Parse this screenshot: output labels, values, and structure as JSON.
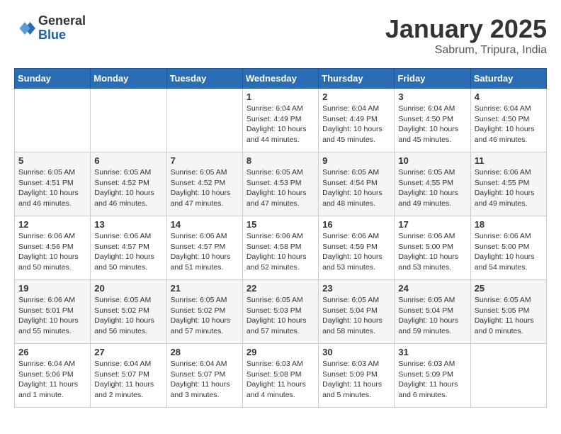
{
  "header": {
    "logo_general": "General",
    "logo_blue": "Blue",
    "month_title": "January 2025",
    "location": "Sabrum, Tripura, India"
  },
  "days_of_week": [
    "Sunday",
    "Monday",
    "Tuesday",
    "Wednesday",
    "Thursday",
    "Friday",
    "Saturday"
  ],
  "weeks": [
    [
      {
        "day": "",
        "info": ""
      },
      {
        "day": "",
        "info": ""
      },
      {
        "day": "",
        "info": ""
      },
      {
        "day": "1",
        "info": "Sunrise: 6:04 AM\nSunset: 4:49 PM\nDaylight: 10 hours\nand 44 minutes."
      },
      {
        "day": "2",
        "info": "Sunrise: 6:04 AM\nSunset: 4:49 PM\nDaylight: 10 hours\nand 45 minutes."
      },
      {
        "day": "3",
        "info": "Sunrise: 6:04 AM\nSunset: 4:50 PM\nDaylight: 10 hours\nand 45 minutes."
      },
      {
        "day": "4",
        "info": "Sunrise: 6:04 AM\nSunset: 4:50 PM\nDaylight: 10 hours\nand 46 minutes."
      }
    ],
    [
      {
        "day": "5",
        "info": "Sunrise: 6:05 AM\nSunset: 4:51 PM\nDaylight: 10 hours\nand 46 minutes."
      },
      {
        "day": "6",
        "info": "Sunrise: 6:05 AM\nSunset: 4:52 PM\nDaylight: 10 hours\nand 46 minutes."
      },
      {
        "day": "7",
        "info": "Sunrise: 6:05 AM\nSunset: 4:52 PM\nDaylight: 10 hours\nand 47 minutes."
      },
      {
        "day": "8",
        "info": "Sunrise: 6:05 AM\nSunset: 4:53 PM\nDaylight: 10 hours\nand 47 minutes."
      },
      {
        "day": "9",
        "info": "Sunrise: 6:05 AM\nSunset: 4:54 PM\nDaylight: 10 hours\nand 48 minutes."
      },
      {
        "day": "10",
        "info": "Sunrise: 6:05 AM\nSunset: 4:55 PM\nDaylight: 10 hours\nand 49 minutes."
      },
      {
        "day": "11",
        "info": "Sunrise: 6:06 AM\nSunset: 4:55 PM\nDaylight: 10 hours\nand 49 minutes."
      }
    ],
    [
      {
        "day": "12",
        "info": "Sunrise: 6:06 AM\nSunset: 4:56 PM\nDaylight: 10 hours\nand 50 minutes."
      },
      {
        "day": "13",
        "info": "Sunrise: 6:06 AM\nSunset: 4:57 PM\nDaylight: 10 hours\nand 50 minutes."
      },
      {
        "day": "14",
        "info": "Sunrise: 6:06 AM\nSunset: 4:57 PM\nDaylight: 10 hours\nand 51 minutes."
      },
      {
        "day": "15",
        "info": "Sunrise: 6:06 AM\nSunset: 4:58 PM\nDaylight: 10 hours\nand 52 minutes."
      },
      {
        "day": "16",
        "info": "Sunrise: 6:06 AM\nSunset: 4:59 PM\nDaylight: 10 hours\nand 53 minutes."
      },
      {
        "day": "17",
        "info": "Sunrise: 6:06 AM\nSunset: 5:00 PM\nDaylight: 10 hours\nand 53 minutes."
      },
      {
        "day": "18",
        "info": "Sunrise: 6:06 AM\nSunset: 5:00 PM\nDaylight: 10 hours\nand 54 minutes."
      }
    ],
    [
      {
        "day": "19",
        "info": "Sunrise: 6:06 AM\nSunset: 5:01 PM\nDaylight: 10 hours\nand 55 minutes."
      },
      {
        "day": "20",
        "info": "Sunrise: 6:05 AM\nSunset: 5:02 PM\nDaylight: 10 hours\nand 56 minutes."
      },
      {
        "day": "21",
        "info": "Sunrise: 6:05 AM\nSunset: 5:02 PM\nDaylight: 10 hours\nand 57 minutes."
      },
      {
        "day": "22",
        "info": "Sunrise: 6:05 AM\nSunset: 5:03 PM\nDaylight: 10 hours\nand 57 minutes."
      },
      {
        "day": "23",
        "info": "Sunrise: 6:05 AM\nSunset: 5:04 PM\nDaylight: 10 hours\nand 58 minutes."
      },
      {
        "day": "24",
        "info": "Sunrise: 6:05 AM\nSunset: 5:04 PM\nDaylight: 10 hours\nand 59 minutes."
      },
      {
        "day": "25",
        "info": "Sunrise: 6:05 AM\nSunset: 5:05 PM\nDaylight: 11 hours\nand 0 minutes."
      }
    ],
    [
      {
        "day": "26",
        "info": "Sunrise: 6:04 AM\nSunset: 5:06 PM\nDaylight: 11 hours\nand 1 minute."
      },
      {
        "day": "27",
        "info": "Sunrise: 6:04 AM\nSunset: 5:07 PM\nDaylight: 11 hours\nand 2 minutes."
      },
      {
        "day": "28",
        "info": "Sunrise: 6:04 AM\nSunset: 5:07 PM\nDaylight: 11 hours\nand 3 minutes."
      },
      {
        "day": "29",
        "info": "Sunrise: 6:03 AM\nSunset: 5:08 PM\nDaylight: 11 hours\nand 4 minutes."
      },
      {
        "day": "30",
        "info": "Sunrise: 6:03 AM\nSunset: 5:09 PM\nDaylight: 11 hours\nand 5 minutes."
      },
      {
        "day": "31",
        "info": "Sunrise: 6:03 AM\nSunset: 5:09 PM\nDaylight: 11 hours\nand 6 minutes."
      },
      {
        "day": "",
        "info": ""
      }
    ]
  ]
}
